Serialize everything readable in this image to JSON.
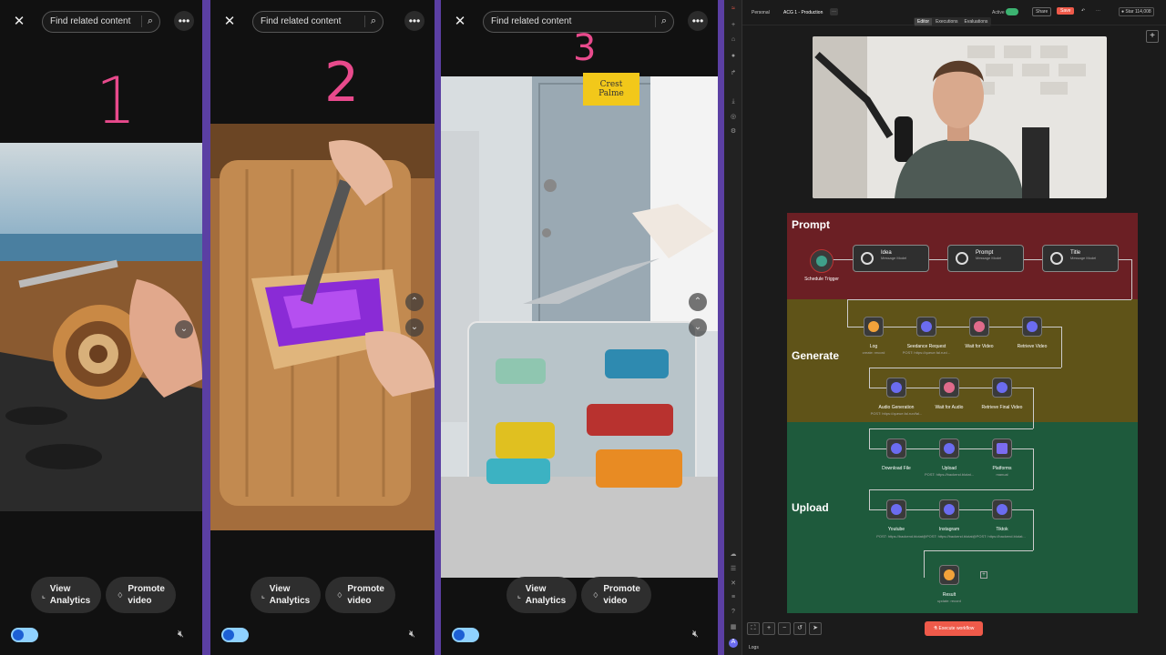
{
  "panels": [
    {
      "search_placeholder": "Find related content",
      "number": "1",
      "view_analytics": "View\nAnalytics",
      "promote": "Promote\nvideo"
    },
    {
      "search_placeholder": "Find related content",
      "number": "2",
      "view_analytics": "View\nAnalytics",
      "promote": "Promote\nvideo"
    },
    {
      "search_placeholder": "Find related content",
      "number": "3",
      "view_analytics": "View\nAnalytics",
      "promote": "Promote\nvideo",
      "sign_text": "Crest Palme"
    }
  ],
  "app": {
    "breadcrumb_workspace": "Personal",
    "breadcrumb_project": "ACG 1 - Production",
    "tabs": [
      "Editor",
      "Executions",
      "Evaluations"
    ],
    "active_label": "Active",
    "share_label": "Share",
    "save_label": "Save",
    "star_label": "Star",
    "star_count": "114,008",
    "sections": {
      "prompt": "Prompt",
      "generate": "Generate",
      "upload": "Upload"
    },
    "nodes": {
      "schedule": "Schedule Trigger",
      "idea": "Idea",
      "idea_sub": "Message Model",
      "prompt": "Prompt",
      "prompt_sub": "Message Model",
      "title": "Title",
      "title_sub": "Message Model",
      "log": "Log",
      "log_sub": "create: record",
      "seedance": "Seedance Request",
      "seedance_sub": "POST: https://queue.fal.run/...",
      "wait_video": "Wait for Video",
      "retrieve_video": "Retrieve Video",
      "audio_gen": "Audio Generation",
      "audio_gen_sub": "POST: https://queue.fal.run/fal...",
      "wait_audio": "Wait for Audio",
      "retrieve_final": "Retrieve Final Video",
      "download": "Download File",
      "upload": "Upload",
      "upload_sub": "POST: https://backend.blotat...",
      "platforms": "Platforms",
      "platforms_sub": "manual",
      "youtube": "Youtube",
      "instagram": "Instagram",
      "tiktok": "Tiktok",
      "social_sub": "POST: https://backend.blotat@POST: https://backend.blotat@POST: https://backend.blotat...",
      "result": "Result",
      "result_sub": "update: record"
    },
    "execute_label": "Execute workflow",
    "logs_label": "Logs"
  }
}
